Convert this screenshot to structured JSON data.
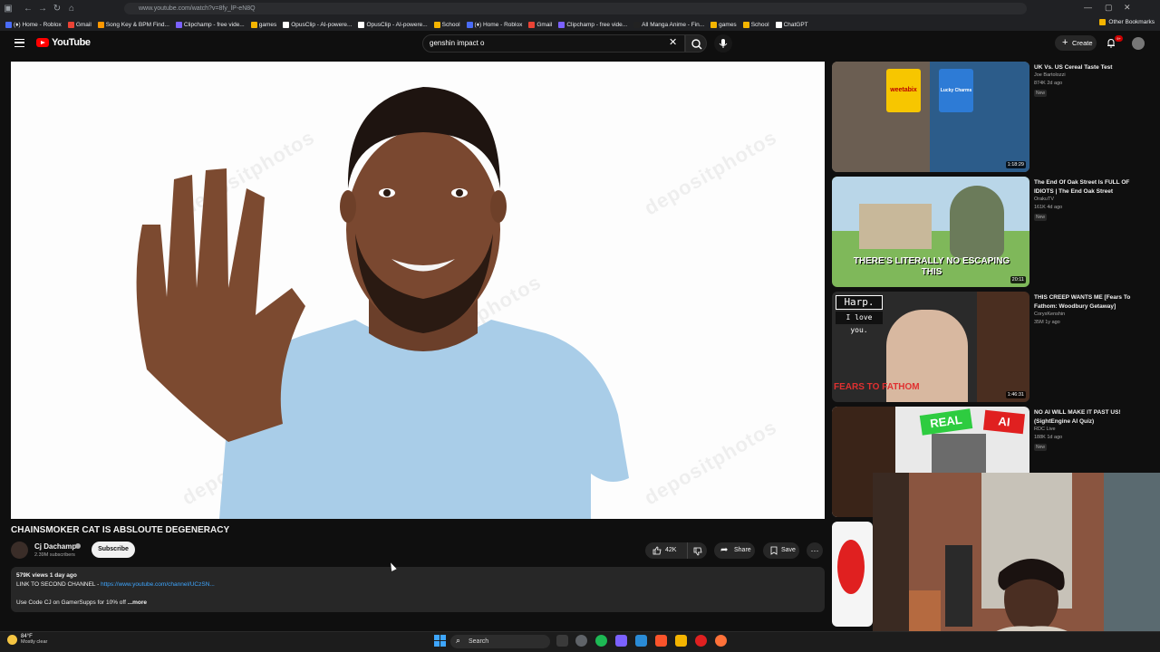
{
  "browser": {
    "url": "www.youtube.com/watch?v=8fy_lP-eN8Q",
    "bookmarks": [
      {
        "label": "(♦) Home - Roblox",
        "color": "#4a6cf7"
      },
      {
        "label": "Gmail",
        "color": "#ea4335"
      },
      {
        "label": "Song Key & BPM Find...",
        "color": "#ff9800"
      },
      {
        "label": "Clipchamp - free vide...",
        "color": "#7b61ff"
      },
      {
        "label": "games",
        "color": "#f4b400"
      },
      {
        "label": "OpusClip - AI-powere...",
        "color": "#ffffff"
      },
      {
        "label": "OpusClip - AI-powere...",
        "color": "#ffffff"
      },
      {
        "label": "School",
        "color": "#f4b400"
      },
      {
        "label": "(♦) Home - Roblox",
        "color": "#4a6cf7"
      },
      {
        "label": "Gmail",
        "color": "#ea4335"
      },
      {
        "label": "Clipchamp - free vide...",
        "color": "#7b61ff"
      },
      {
        "label": "All Manga Anime - Fin...",
        "color": "#222222"
      },
      {
        "label": "games",
        "color": "#f4b400"
      },
      {
        "label": "School",
        "color": "#f4b400"
      },
      {
        "label": "ChatGPT",
        "color": "#ffffff"
      }
    ],
    "other_bookmarks": "Other Bookmarks"
  },
  "header": {
    "logo_text": "YouTube",
    "search_value": "genshin impact o",
    "create_label": "Create",
    "notification_count": "9+"
  },
  "video": {
    "title": "CHAINSMOKER CAT IS ABSLOUTE DEGENERACY",
    "watermark": "depositphotos",
    "channel_name": "Cj Dachamp",
    "subscribers": "2.39M subscribers",
    "subscribe_label": "Subscribe",
    "likes": "42K",
    "share_label": "Share",
    "save_label": "Save",
    "views_date": "579K views  1 day ago",
    "desc_line1_prefix": "LINK TO SECOND CHANNEL - ",
    "desc_link": "https://www.youtube.com/channel/UCzSN...",
    "desc_line2": "Use Code CJ on GamerSupps for 10% off ",
    "desc_more": "...more"
  },
  "recommended": [
    {
      "title": "UK Vs. US Cereal Taste Test",
      "channel": "Joe Bartolozzi",
      "meta": "874K  2d ago",
      "badge": "New",
      "duration": "1:18:29"
    },
    {
      "title": "The End Of Oak Street Is FULL OF IDIOTS | The End Oak Street",
      "channel": "OrakuTV",
      "meta": "161K  4d ago",
      "badge": "New",
      "duration": "20:11"
    },
    {
      "title": "THIS CREEP WANTS ME [Fears To Fathom: Woodbury Getaway]",
      "channel": "CoryxKenshin",
      "meta": "35M  1y ago",
      "badge": "",
      "duration": "1:46:31"
    },
    {
      "title": "NO AI WILL MAKE IT PAST US! (SightEngine AI Quiz)",
      "channel": "RDC Live",
      "meta": "188K  1d ago",
      "badge": "New",
      "duration": ""
    }
  ],
  "thumb_text": {
    "cereal1": "weetabix",
    "cereal2": "Lucky Charms",
    "escaping": "THERE'S LITERALLY NO ESCAPING THIS",
    "harp": "Harp.",
    "love": "I love you.",
    "fears": "FEARS TO FATHOM",
    "real": "REAL",
    "ai": "AI"
  },
  "taskbar": {
    "temp": "84°F",
    "weather": "Mostly clear",
    "search": "Search"
  }
}
